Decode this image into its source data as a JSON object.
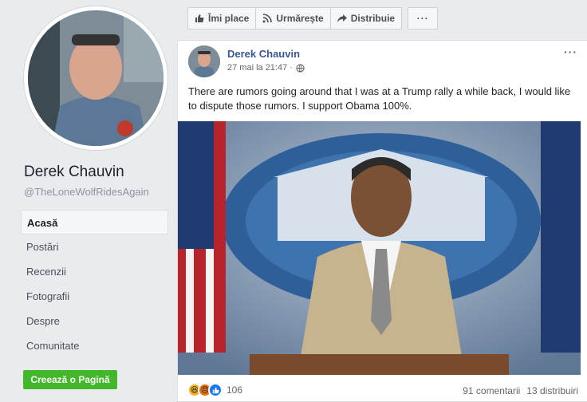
{
  "sidebar": {
    "page_name": "Derek Chauvin",
    "handle": "@TheLoneWolfRidesAgain",
    "nav": [
      {
        "label": "Acasă",
        "active": true
      },
      {
        "label": "Postări"
      },
      {
        "label": "Recenzii"
      },
      {
        "label": "Fotografii"
      },
      {
        "label": "Despre"
      },
      {
        "label": "Comunitate"
      }
    ],
    "create_page_label": "Creează o Pagină"
  },
  "actionbar": {
    "like_label": "Îmi place",
    "follow_label": "Urmărește",
    "share_label": "Distribuie",
    "more_label": "···"
  },
  "post": {
    "author": "Derek Chauvin",
    "time": "27 mai la 21:47 ·",
    "menu": "···",
    "text": "There are rumors going around that I was at a Trump rally a while back, I would like to dispute those rumors. I support Obama 100%.",
    "reaction_count": "106",
    "comments": "91 comentarii",
    "shares": "13 distribuiri"
  },
  "colors": {
    "link_blue": "#385898",
    "green_button": "#42b72a",
    "background": "#e9ebee"
  }
}
